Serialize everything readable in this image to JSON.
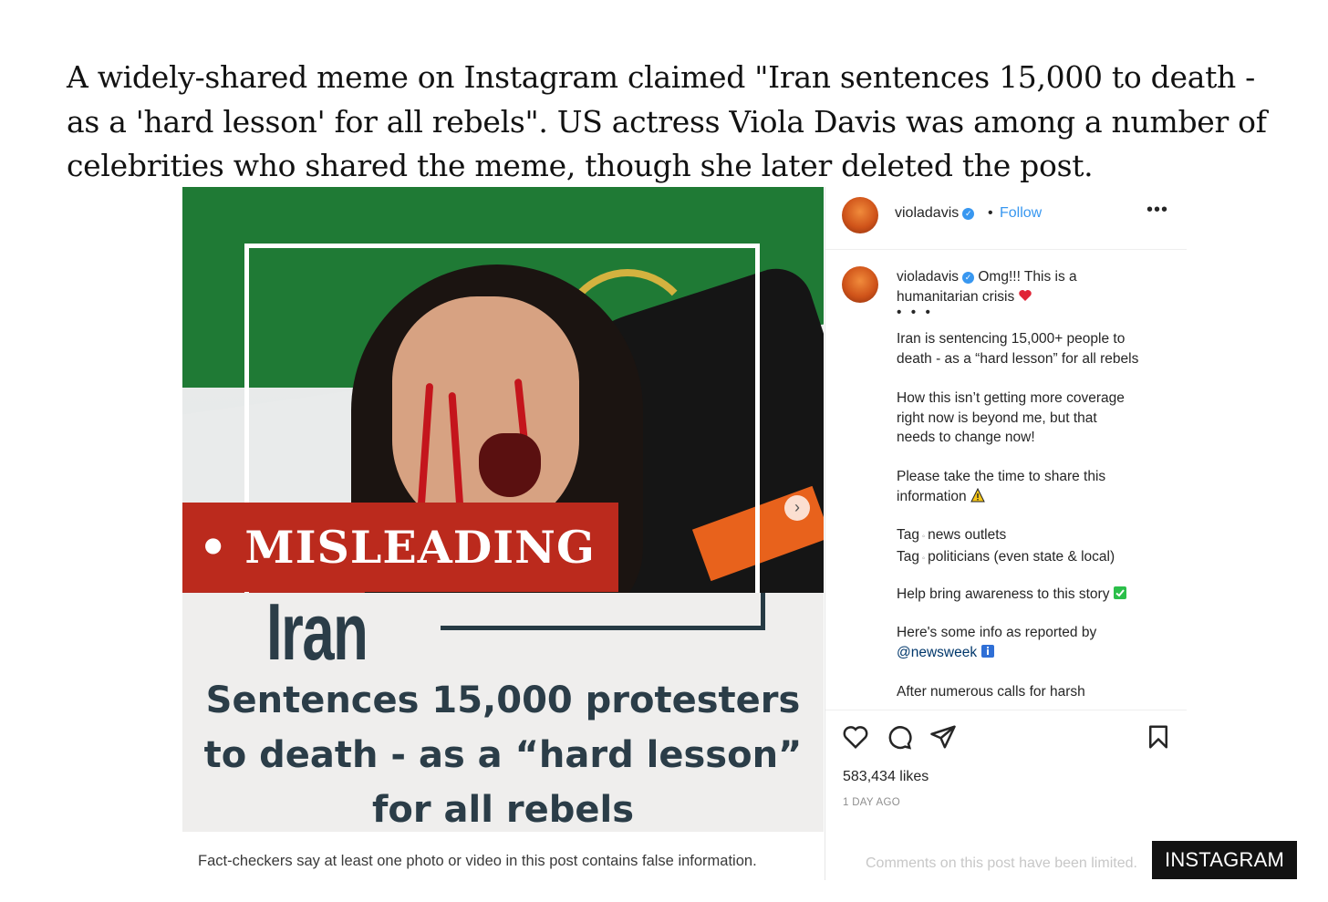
{
  "caption": "A widely-shared meme on Instagram claimed \"Iran sentences 15,000 to death - as a 'hard lesson' for all rebels\". US actress Viola Davis was among a number of celebrities who shared the meme, though she later deleted the post.",
  "post_image": {
    "badge": "• MISLEADING",
    "title": "Iran",
    "headline_lines": [
      "Sentences 15,000 protesters",
      "to death - as a “hard lesson”",
      "for all rebels"
    ],
    "fact_check": "Fact-checkers say at least one photo or video in this post contains false information.",
    "next_icon": "chevron-right-icon"
  },
  "instagram": {
    "username": "violadavis",
    "separator": "•",
    "follow_label": "Follow",
    "more_label": "•••",
    "comment": {
      "username": "violadavis",
      "line1": "Omg!!! This is a",
      "line2": "humanitarian crisis",
      "dots": "• • •",
      "p1": [
        "Iran is sentencing 15,000+ people to",
        "death - as a “hard lesson” for all rebels"
      ],
      "p2": [
        "How this isn’t getting more coverage",
        "right now is beyond me, but that",
        "needs to change now!"
      ],
      "p3": [
        "Please take the time to share this",
        "information"
      ],
      "p4a_label": "Tag",
      "p4a_text": "news outlets",
      "p4b_label": "Tag",
      "p4b_text": "politicians (even state & local)",
      "p5": "Help bring awareness to this story",
      "p6a": "Here's some info as reported by",
      "p6b": "@newsweek",
      "p7": "After numerous calls for harsh"
    },
    "likes": "583,434 likes",
    "time_ago": "1 DAY AGO",
    "comments_limited": "Comments on this post have been limited.",
    "icons": [
      "heart-icon",
      "comment-icon",
      "share-icon",
      "bookmark-icon"
    ],
    "colors": {
      "link": "#3897f0",
      "heart": "#e02436",
      "check": "#2bbf4a"
    }
  },
  "credit": "INSTAGRAM"
}
